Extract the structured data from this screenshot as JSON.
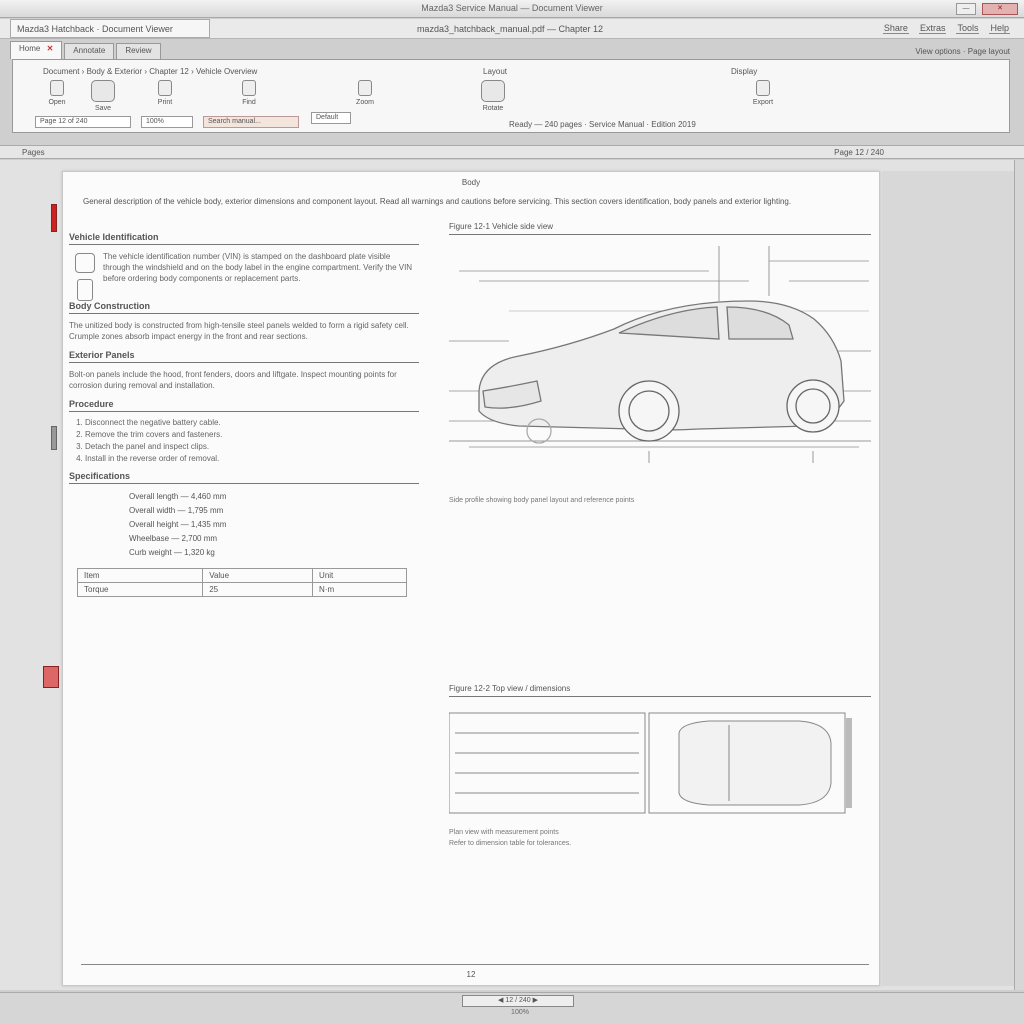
{
  "window": {
    "title": "Mazda3 Service Manual — Document Viewer",
    "min_label": "—",
    "close_label": "✕"
  },
  "menubar": {
    "left": "Mazda3 Hatchback · Document Viewer",
    "center": "mazda3_hatchback_manual.pdf — Chapter 12",
    "items": [
      "Share",
      "Extras",
      "Tools",
      "Help"
    ]
  },
  "ribbon": {
    "tabs": [
      {
        "label": "Home"
      },
      {
        "label": "Annotate"
      },
      {
        "label": "Review"
      }
    ],
    "info": "View options · Page layout",
    "path": "Document › Body & Exterior › Chapter 12 › Vehicle Overview",
    "path2": "Layout",
    "path3": "Display",
    "buttons": [
      "Open",
      "Save",
      "Print",
      "Find",
      "Zoom",
      "Rotate",
      "Export"
    ],
    "inputs": {
      "page": "Page 12 of 240",
      "search": "Search manual...",
      "zoom": "100%",
      "font": "Default"
    },
    "status": "Ready — 240 pages · Service Manual · Edition 2019"
  },
  "strip": {
    "left": "Pages",
    "right": "Page 12 / 240"
  },
  "page": {
    "header": "Body",
    "intro": "General description of the vehicle body, exterior dimensions and component layout. Read all warnings and cautions before servicing. This section covers identification, body panels and exterior lighting.",
    "sections": [
      {
        "title": "Vehicle Identification",
        "text": "The vehicle identification number (VIN) is stamped on the dashboard plate visible through the windshield and on the body label in the engine compartment. Verify the VIN before ordering body components or replacement parts."
      },
      {
        "title": "Body Construction",
        "text": "The unitized body is constructed from high-tensile steel panels welded to form a rigid safety cell. Crumple zones absorb impact energy in the front and rear sections."
      },
      {
        "title": "Exterior Panels",
        "text": "Bolt-on panels include the hood, front fenders, doors and liftgate. Inspect mounting points for corrosion during removal and installation."
      },
      {
        "title": "Procedure",
        "steps": [
          "Disconnect the negative battery cable.",
          "Remove the trim covers and fasteners.",
          "Detach the panel and inspect clips.",
          "Install in the reverse order of removal."
        ]
      }
    ],
    "specs_title": "Specifications",
    "specs": [
      {
        "k": "Overall length",
        "v": "4,460 mm"
      },
      {
        "k": "Overall width",
        "v": "1,795 mm"
      },
      {
        "k": "Overall height",
        "v": "1,435 mm"
      },
      {
        "k": "Wheelbase",
        "v": "2,700 mm"
      },
      {
        "k": "Curb weight",
        "v": "1,320 kg"
      }
    ],
    "table": [
      [
        "Item",
        "Value",
        "Unit"
      ],
      [
        "Torque",
        "25",
        "N·m"
      ]
    ],
    "figure1_title": "Figure 12-1  Vehicle side view",
    "figure1_caption": "Side profile showing body panel layout and reference points",
    "figure2_title": "Figure 12-2  Top view / dimensions",
    "figure2_caption": "Plan view with measurement points",
    "figure2_note": "Refer to dimension table for tolerances.",
    "page_number": "12"
  },
  "bottom": {
    "pager": "◀  12 / 240  ▶",
    "zoom": "100%"
  }
}
